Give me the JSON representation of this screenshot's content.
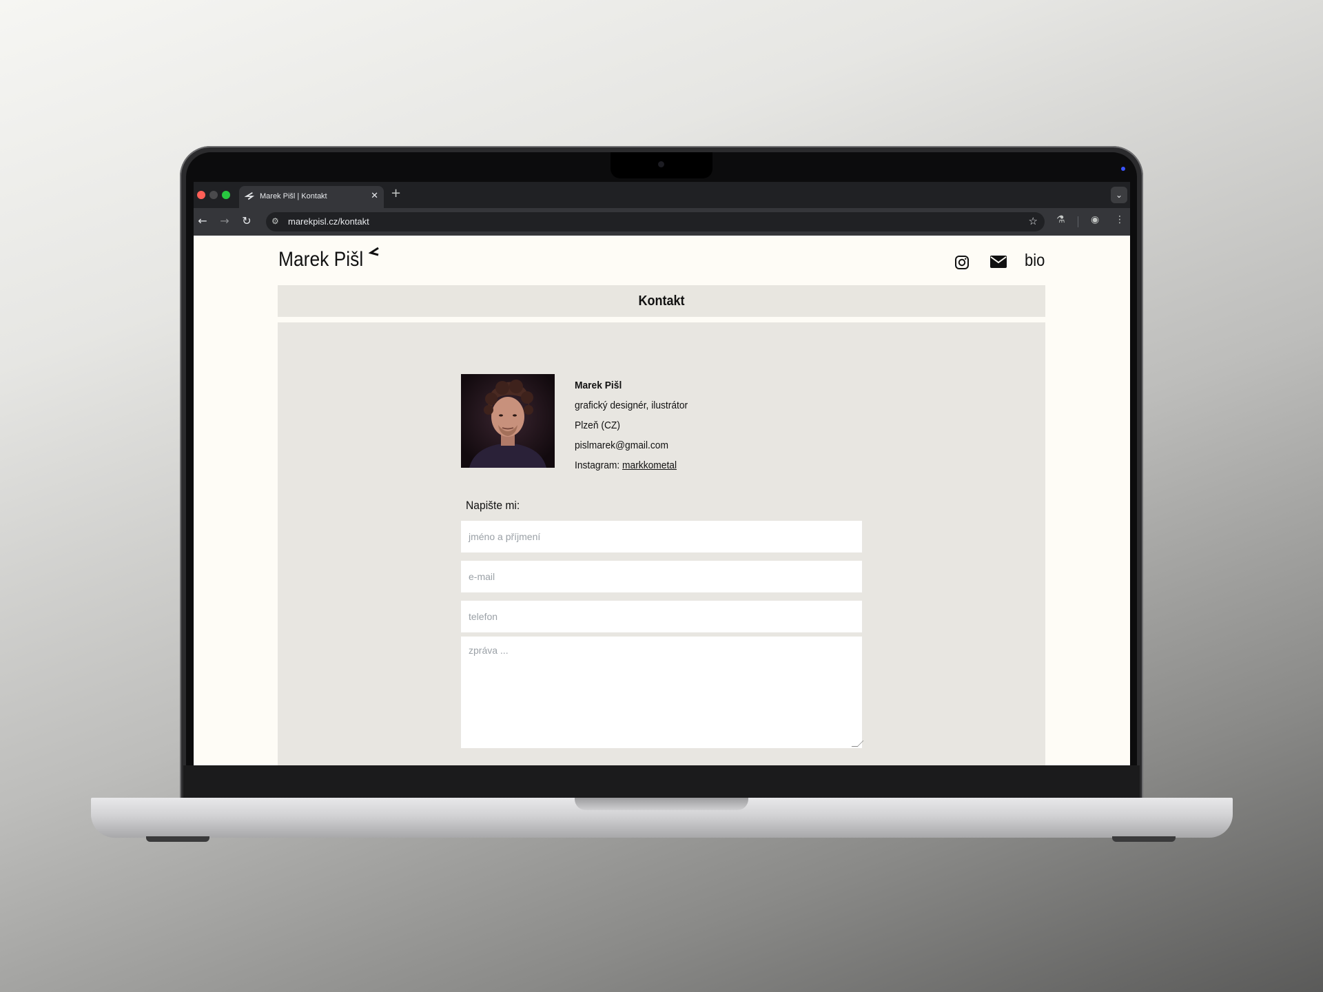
{
  "browser": {
    "tab_title": "Marek Pišl | Kontakt",
    "tab_close": "✕",
    "new_tab": "+",
    "url": "marekpisl.cz/kontakt",
    "traffic_colors": [
      "#ff5f57",
      "#4a4a4c",
      "#28c840"
    ]
  },
  "site": {
    "logo": "Marek Pišl",
    "nav_bio": "bio",
    "page_title": "Kontakt"
  },
  "contact": {
    "name": "Marek Pišl",
    "role": "grafický designér, ilustrátor",
    "city": "Plzeň (CZ)",
    "email": "pislmarek@gmail.com",
    "instagram_label": "Instagram:",
    "instagram_handle": "markkometal"
  },
  "form": {
    "label": "Napište mi:",
    "name_placeholder": "jméno a příjmení",
    "email_placeholder": "e-mail",
    "phone_placeholder": "telefon",
    "message_placeholder": "zpráva ..."
  },
  "icons": [
    "instagram-icon",
    "mail-icon",
    "star-icon",
    "back-icon",
    "forward-icon",
    "reload-icon",
    "labs-icon",
    "profile-icon",
    "menu-icon"
  ]
}
